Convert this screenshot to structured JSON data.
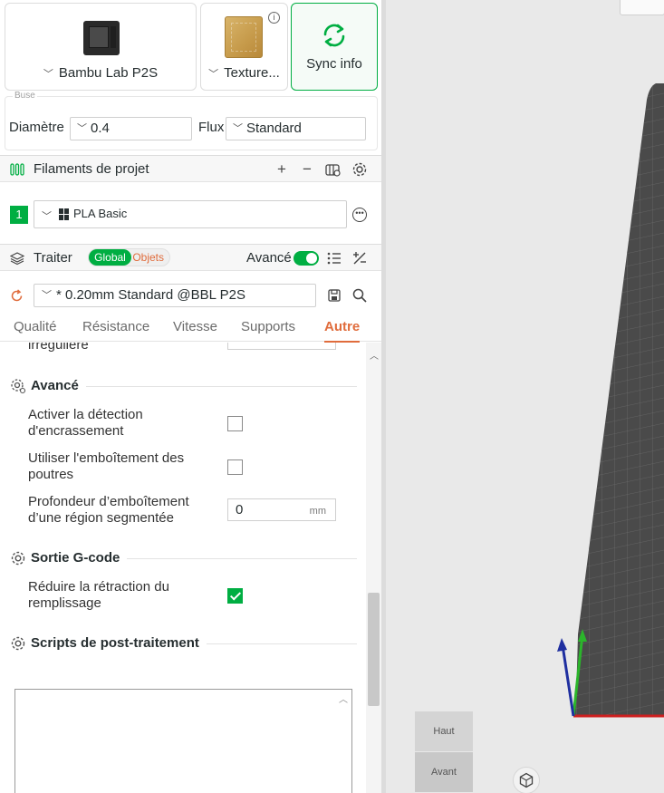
{
  "printer": {
    "name": "Bambu Lab P2S"
  },
  "plate": {
    "name": "Texture..."
  },
  "sync": {
    "label": "Sync info"
  },
  "nozzle": {
    "legend": "Buse",
    "diameter_label": "Diamètre",
    "diameter_value": "0.4",
    "flow_label": "Flux",
    "flow_value": "Standard"
  },
  "filaments": {
    "title": "Filaments de projet",
    "items": [
      {
        "index": "1",
        "name": "PLA Basic",
        "color": "#00ae42"
      }
    ]
  },
  "process": {
    "title": "Traiter",
    "scope_on": "Global",
    "scope_off": "Objets",
    "advanced_label": "Avancé",
    "advanced_on": true,
    "preset": "* 0.20mm Standard @BBL P2S"
  },
  "tabs": [
    {
      "label": "Qualité",
      "active": false
    },
    {
      "label": "Résistance",
      "active": false
    },
    {
      "label": "Vitesse",
      "active": false
    },
    {
      "label": "Supports",
      "active": false
    },
    {
      "label": "Autre",
      "active": true
    }
  ],
  "settings": {
    "partial_label": "irrégulière",
    "groups": {
      "advanced": {
        "title": "Avancé",
        "options": {
          "clog_detection": {
            "label": "Activer la détection d'encrassement",
            "checked": false
          },
          "beam_interlocking": {
            "label": "Utiliser l'emboîtement des poutres",
            "checked": false
          },
          "interlock_depth": {
            "label": "Profondeur d’emboîtement d’une région segmentée",
            "value": "0",
            "unit": "mm"
          }
        }
      },
      "gcode": {
        "title": "Sortie G-code",
        "options": {
          "reduce_retraction": {
            "label": "Réduire la rétraction du remplissage",
            "checked": true
          }
        }
      },
      "post": {
        "title": "Scripts de post-traitement",
        "script": ""
      }
    }
  },
  "viewport": {
    "cube_top": "Haut",
    "cube_front": "Avant",
    "bed_color": "#4a4a4a",
    "axis_x_color": "#cc1f1f",
    "axis_y_color": "#2bb52b",
    "axis_z_color": "#1f2fa0"
  },
  "colors": {
    "accent": "#00ae42",
    "highlight": "#e06c3c"
  }
}
